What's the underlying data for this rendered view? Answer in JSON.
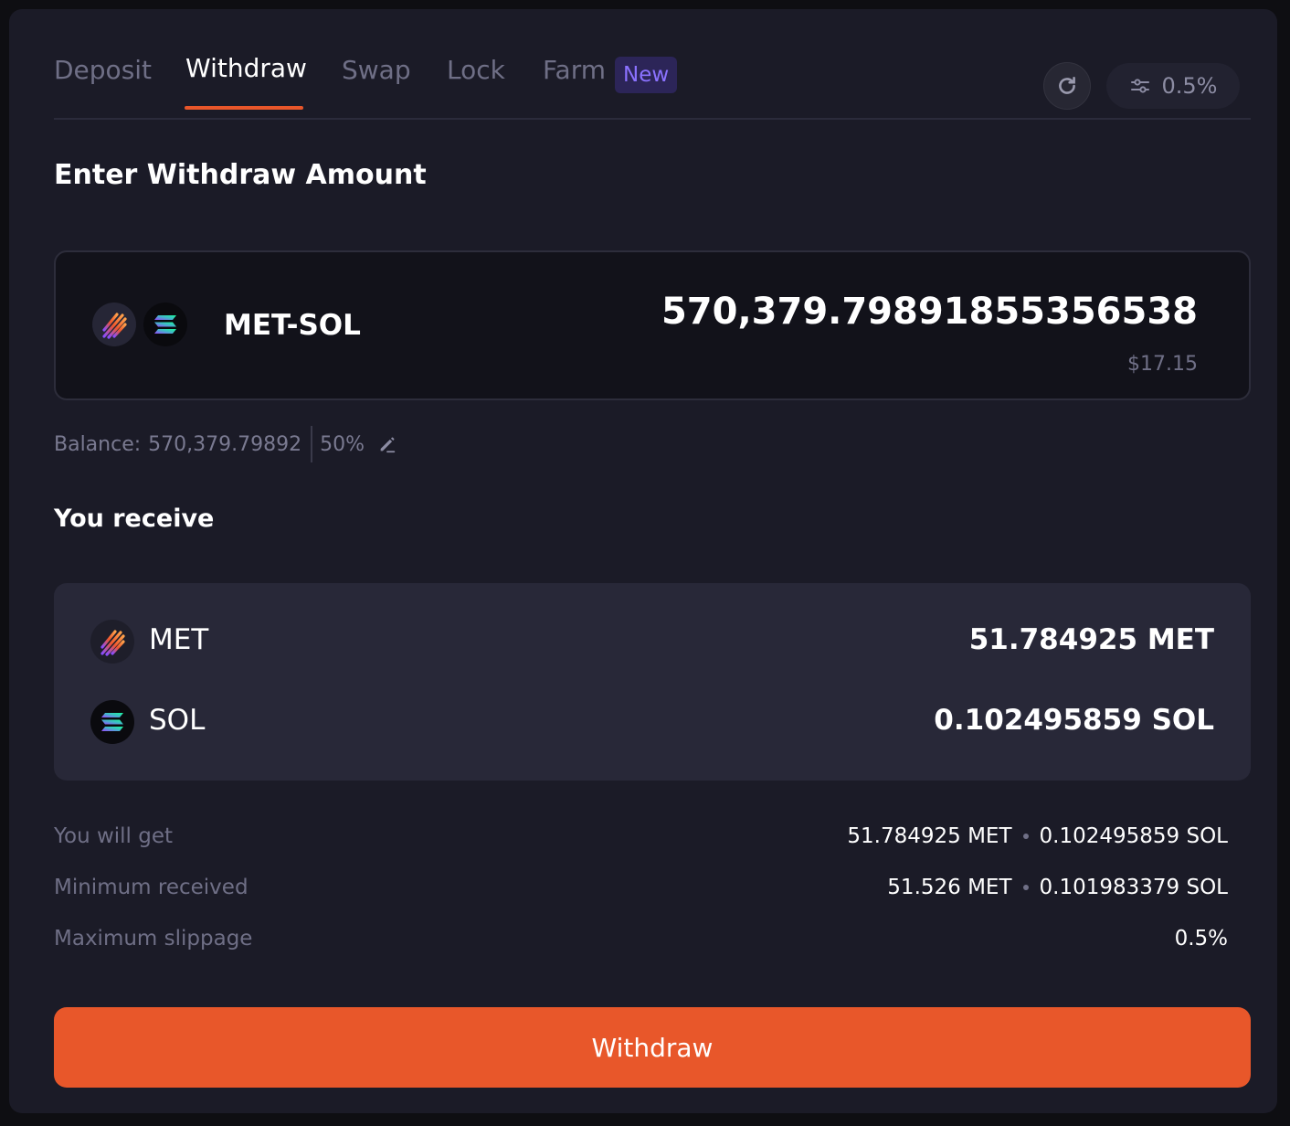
{
  "tabs": {
    "deposit": "Deposit",
    "withdraw": "Withdraw",
    "swap": "Swap",
    "lock": "Lock",
    "farm": "Farm",
    "new_badge": "New"
  },
  "toolbar": {
    "refresh_icon": "refresh-icon",
    "settings_icon": "sliders-icon",
    "slippage": "0.5%"
  },
  "withdraw": {
    "title": "Enter Withdraw Amount",
    "pair": "MET-SOL",
    "amount": "570,379.79891855356538",
    "usd_value": "$17.15",
    "balance_label": "Balance:",
    "balance_value": "570,379.79892",
    "percent": "50%",
    "edit_icon": "pencil-icon"
  },
  "receive": {
    "title": "You receive",
    "items": [
      {
        "token": "MET",
        "amount": "51.784925 MET",
        "icon": "met-token-icon"
      },
      {
        "token": "SOL",
        "amount": "0.102495859 SOL",
        "icon": "sol-token-icon"
      }
    ]
  },
  "summary": {
    "you_will_get_label": "You will get",
    "you_will_get_met": "51.784925 MET",
    "you_will_get_sol": "0.102495859 SOL",
    "minimum_received_label": "Minimum received",
    "minimum_received_met": "51.526 MET",
    "minimum_received_sol": "0.101983379 SOL",
    "max_slippage_label": "Maximum slippage",
    "max_slippage_value": "0.5%"
  },
  "action": {
    "withdraw_button": "Withdraw"
  },
  "colors": {
    "accent": "#e8572a",
    "badge": "#8b72ff",
    "background": "#1b1b27"
  }
}
